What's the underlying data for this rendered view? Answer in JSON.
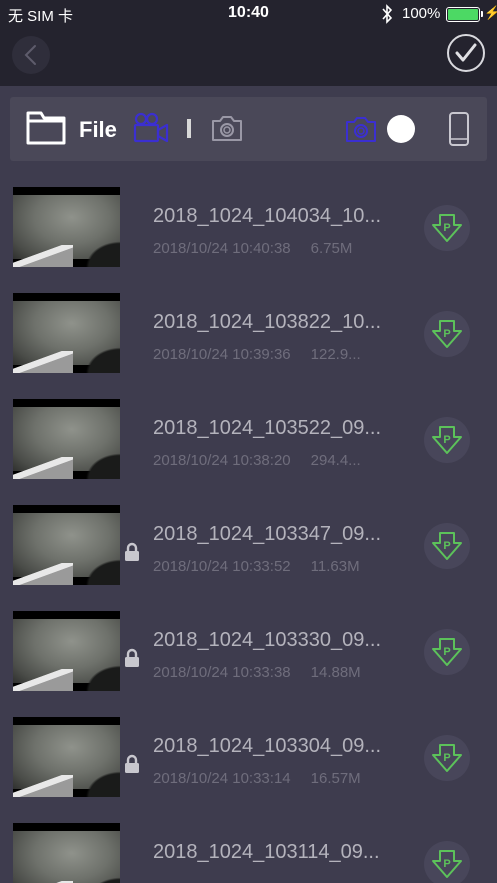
{
  "status_bar": {
    "carrier": "无 SIM 卡",
    "time": "10:40",
    "battery": "100%",
    "battery_level": 1.0
  },
  "navbar": {
    "back_icon": "chevron-left-icon",
    "confirm_icon": "checkmark-circle-icon"
  },
  "toolbar": {
    "file_label": "File",
    "video_icon": "video-camera-icon",
    "photo_icon": "camera-icon",
    "mode_camera_icon": "camera-icon",
    "phone_icon": "phone-icon",
    "accent_color": "#3b2fd1",
    "inactive_color": "#9a98a6"
  },
  "files": [
    {
      "name": "2018_1024_104034_10...",
      "date": "2018/10/24 10:40:38",
      "size": "6.75M",
      "locked": false
    },
    {
      "name": "2018_1024_103822_10...",
      "date": "2018/10/24 10:39:36",
      "size": "122.9...",
      "locked": false
    },
    {
      "name": "2018_1024_103522_09...",
      "date": "2018/10/24 10:38:20",
      "size": "294.4...",
      "locked": false
    },
    {
      "name": "2018_1024_103347_09...",
      "date": "2018/10/24 10:33:52",
      "size": "11.63M",
      "locked": true
    },
    {
      "name": "2018_1024_103330_09...",
      "date": "2018/10/24 10:33:38",
      "size": "14.88M",
      "locked": true
    },
    {
      "name": "2018_1024_103304_09...",
      "date": "2018/10/24 10:33:14",
      "size": "16.57M",
      "locked": true
    },
    {
      "name": "2018_1024_103114_09...",
      "date": "",
      "size": "",
      "locked": false
    }
  ],
  "download_color": "#5cc25a"
}
